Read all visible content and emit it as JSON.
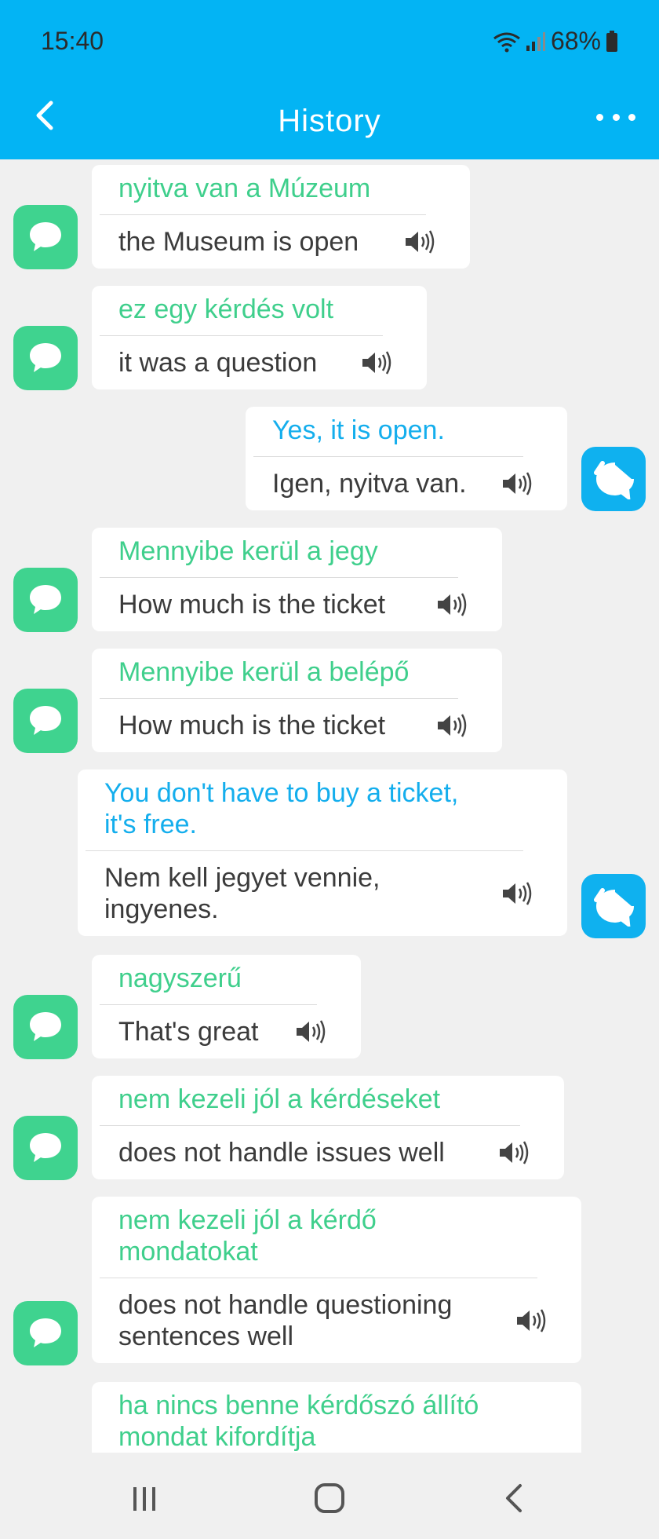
{
  "status": {
    "time": "15:40",
    "battery": "68%"
  },
  "header": {
    "title": "History"
  },
  "messages": [
    {
      "side": "left",
      "source": "nyitva van a Múzeum",
      "translation": "the Museum is open"
    },
    {
      "side": "left",
      "source": "ez egy kérdés volt",
      "translation": "it was a question"
    },
    {
      "side": "right",
      "source": "Yes, it is open.",
      "translation": "Igen, nyitva van."
    },
    {
      "side": "left",
      "source": "Mennyibe kerül a jegy",
      "translation": "How much is the ticket"
    },
    {
      "side": "left",
      "source": "Mennyibe kerül a belépő",
      "translation": "How much is the ticket"
    },
    {
      "side": "right",
      "source": "You don't have to buy a ticket, it's free.",
      "translation": "Nem kell jegyet vennie, ingyenes."
    },
    {
      "side": "left",
      "source": "nagyszerű",
      "translation": "That's great"
    },
    {
      "side": "left",
      "source": "nem kezeli jól a kérdéseket",
      "translation": "does not handle issues well"
    },
    {
      "side": "left",
      "source": "nem kezeli jól a kérdő mondatokat",
      "translation": "does not handle questioning sentences well"
    },
    {
      "side": "left",
      "source": "ha nincs benne kérdőszó állító mondat kifordítja",
      "translation": ""
    }
  ],
  "icons": {
    "avatar_left": "chat-bubble-icon",
    "avatar_right": "chat-bubble-icon",
    "speaker": "speaker-icon",
    "back": "chevron-left-icon",
    "more": "more-dots-icon"
  },
  "colors": {
    "header": "#03b4f4",
    "avatar_left": "#3fd38f",
    "avatar_right": "#0fb1ef",
    "source_left": "#3fcf8c",
    "source_right": "#14aeed"
  }
}
